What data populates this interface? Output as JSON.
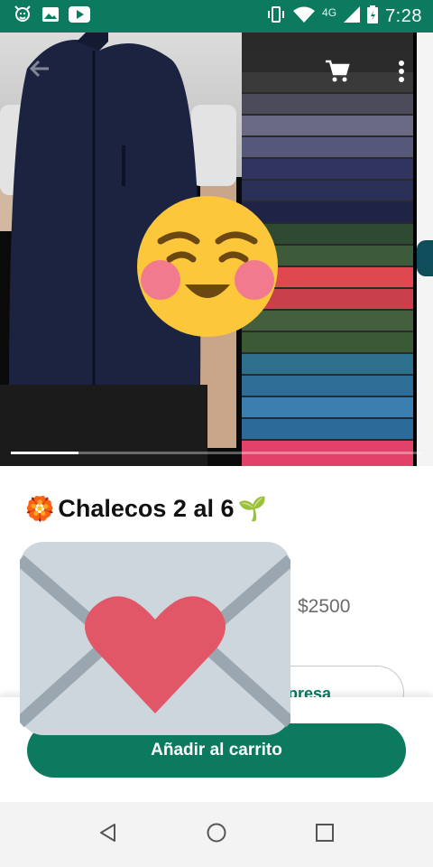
{
  "status_bar": {
    "time": "7:28",
    "network": "4G",
    "icons_left": [
      "mascot-icon",
      "image-icon",
      "youtube-icon"
    ],
    "icons_right": [
      "vibrate-icon",
      "wifi-icon",
      "signal-icon",
      "battery-icon"
    ],
    "background_color": "#0b7a5f"
  },
  "hero": {
    "carousel_position": 1,
    "icons": [
      "back-arrow-icon",
      "cart-icon",
      "more-vert-icon"
    ]
  },
  "product": {
    "title_prefix_emoji": "🏵️",
    "title": "Chalecos 2 al 6",
    "title_suffix_emoji": "🌱",
    "price_prefix": ")",
    "price": "$2500"
  },
  "secondary_action": {
    "label": "presa"
  },
  "primary_action": {
    "label": "Añadir al carrito"
  },
  "overlays": {
    "emoji_top": "blushing-smiling-face",
    "emoji_bottom": "love-letter"
  },
  "accent_color": "#0b7a5f",
  "nav_bar": {
    "buttons": [
      "back-triangle-icon",
      "home-circle-icon",
      "recents-square-icon"
    ]
  }
}
